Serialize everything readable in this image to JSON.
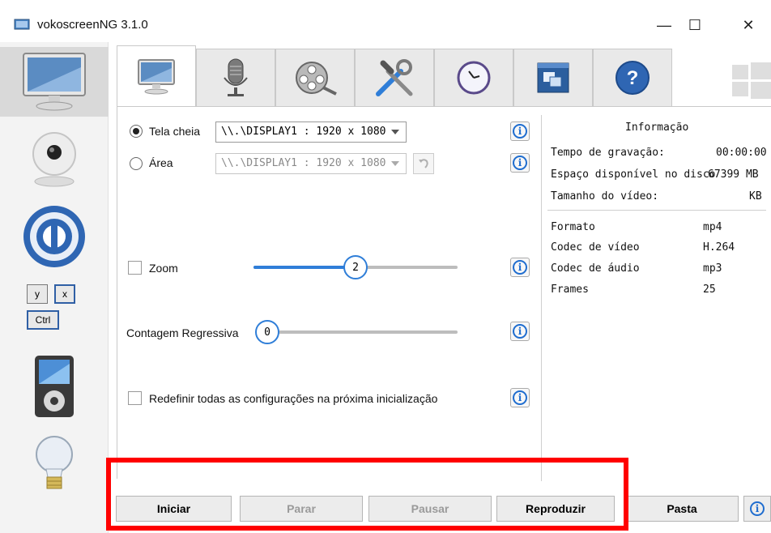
{
  "window": {
    "title": "vokoscreenNG 3.1.0",
    "minimize": "—",
    "maximize": "☐",
    "close": "✕"
  },
  "sidebar": {
    "items": [
      {
        "name": "screencast"
      },
      {
        "name": "camera"
      },
      {
        "name": "player"
      },
      {
        "name": "shortcuts",
        "keys": [
          "y",
          "x",
          "Ctrl"
        ]
      },
      {
        "name": "media-player"
      },
      {
        "name": "tips"
      }
    ]
  },
  "tabs": [
    {
      "name": "screen"
    },
    {
      "name": "audio"
    },
    {
      "name": "video"
    },
    {
      "name": "tools"
    },
    {
      "name": "timer"
    },
    {
      "name": "window"
    },
    {
      "name": "help"
    }
  ],
  "screen": {
    "fullscreen_label": "Tela cheia",
    "fullscreen_value": "\\\\.\\DISPLAY1 :  1920 x 1080",
    "area_label": "Área",
    "area_value": "\\\\.\\DISPLAY1 :  1920 x 1080",
    "zoom_label": "Zoom",
    "zoom_value": "2",
    "zoom_level": 0.5,
    "countdown_label": "Contagem Regressiva",
    "countdown_value": "0",
    "reset_label": "Redefinir todas as configurações na próxima inicialização",
    "info_symbol": "i"
  },
  "info": {
    "title": "Informação",
    "rows": [
      {
        "label": "Tempo de gravação:",
        "value": "00:00:00"
      },
      {
        "label": "Espaço disponível no disco",
        "value": "67399 MB"
      },
      {
        "label": "Tamanho do vídeo:",
        "value": "KB"
      }
    ],
    "format_rows": [
      {
        "label": "Formato",
        "value": "mp4"
      },
      {
        "label": "Codec de vídeo",
        "value": "H.264"
      },
      {
        "label": "Codec de áudio",
        "value": "mp3"
      },
      {
        "label": "Frames",
        "value": "25"
      }
    ]
  },
  "buttons": {
    "start": "Iniciar",
    "stop": "Parar",
    "pause": "Pausar",
    "play": "Reproduzir",
    "folder": "Pasta"
  },
  "colors": {
    "accent": "#2f7ed8",
    "info": "#1f6dcf",
    "highlight": "#ff0000"
  }
}
